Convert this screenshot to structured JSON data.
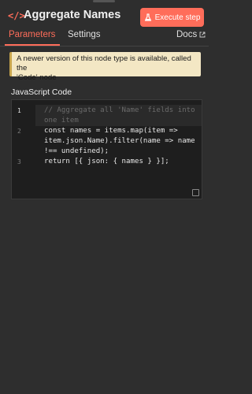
{
  "header": {
    "title": "Aggregate Names",
    "execute_label": "Execute step",
    "node_icon": "code-icon",
    "accent": "#ff6d5a"
  },
  "tabs": {
    "parameters": "Parameters",
    "settings": "Settings",
    "docs": "Docs"
  },
  "notice": {
    "line1": "A newer version of this node type is available, called the",
    "line2": "'Code' node"
  },
  "field": {
    "label": "JavaScript Code"
  },
  "code": {
    "line_numbers": [
      "1",
      "2",
      "3"
    ],
    "lines": [
      "// Aggregate all 'Name' fields into",
      "one item",
      "const names = items.map(item =>",
      "item.json.Name).filter(name => name",
      "!== undefined);",
      "return [{ json: { names } }];"
    ]
  }
}
